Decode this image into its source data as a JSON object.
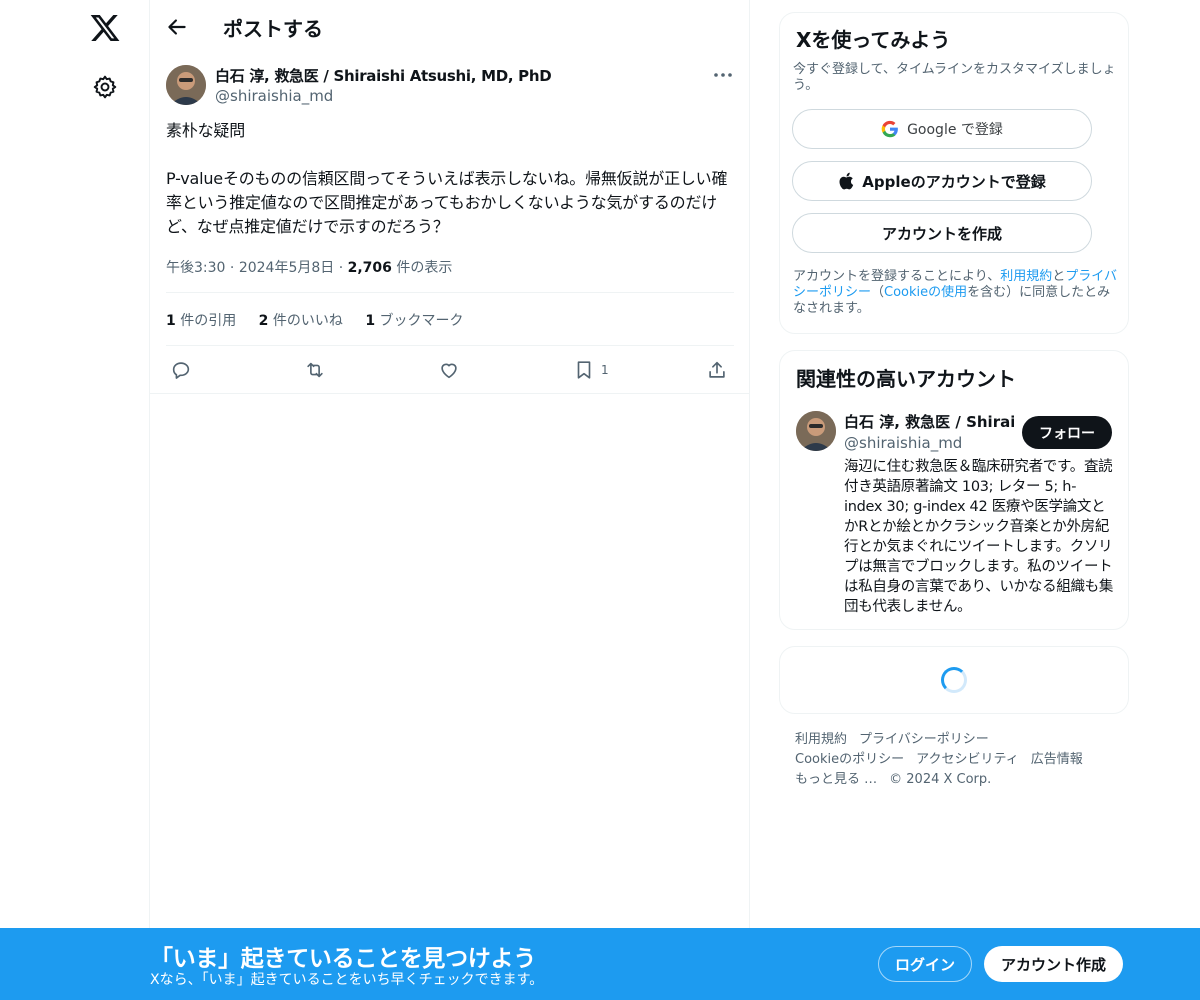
{
  "nav": {
    "logo_icon": "x-logo-icon",
    "settings_icon": "gear-icon"
  },
  "header": {
    "title": "ポストする",
    "back_icon": "arrow-left-icon"
  },
  "post": {
    "author_name": "白石 淳, 救急医 / Shiraishi Atsushi, MD, PhD",
    "author_handle": "@shiraishia_md",
    "body": "素朴な疑問\n\nP-valueそのものの信頼区間ってそういえば表示しないね。帰無仮説が正しい確率という推定値なので区間推定があってもおかしくないような気がするのだけど、なぜ点推定値だけで示すのだろう？",
    "time": "午後3:30",
    "date": "2024年5月8日",
    "views_count": "2,706",
    "views_label": "件の表示",
    "quotes_count": "1",
    "quotes_label": "件の引用",
    "likes_count": "2",
    "likes_label": "件のいいね",
    "bookmarks_count": "1",
    "bookmarks_label": "ブックマーク",
    "bookmark_action_count": "1"
  },
  "signup_panel": {
    "title": "Xを使ってみよう",
    "subtitle": "今すぐ登録して、タイムラインをカスタマイズしましょう。",
    "google_button": "Google で登録",
    "apple_button": "Appleのアカウントで登録",
    "create_button": "アカウントを作成",
    "legal_prefix": "アカウントを登録することにより、",
    "legal_terms": "利用規約",
    "legal_and": "と",
    "legal_privacy": "プライバシーポリシー",
    "legal_paren_open": "（",
    "legal_cookie": "Cookieの使用",
    "legal_suffix": "を含む）に同意したとみなされます。"
  },
  "related_panel": {
    "title": "関連性の高いアカウント",
    "name": "白石 淳, 救急医 / Shiraishi Atsushi, MD, PhD",
    "handle": "@shiraishia_md",
    "follow_button": "フォロー",
    "bio": "海辺に住む救急医＆臨床研究者です。査読付き英語原著論文 103; レター 5; h-index 30; g-index 42 医療や医学論文とかRとか絵とかクラシック音楽とか外房紀行とか気まぐれにツイートします。クソリプは無言でブロックします。私のツイートは私自身の言葉であり、いかなる組織も集団も代表しません。"
  },
  "footer": {
    "terms": "利用規約",
    "privacy": "プライバシーポリシー",
    "cookie": "Cookieのポリシー",
    "accessibility": "アクセシビリティ",
    "ads": "広告情報",
    "more": "もっと見る …",
    "copyright": "© 2024 X Corp."
  },
  "banner": {
    "title": "「いま」起きていることを見つけよう",
    "subtitle": "Xなら、「いま」起きていることをいち早くチェックできます。",
    "login": "ログイン",
    "signup": "アカウント作成"
  },
  "colors": {
    "accent": "#1d9bf0",
    "text": "#0f1419",
    "muted": "#536471",
    "border": "#eff3f4"
  }
}
